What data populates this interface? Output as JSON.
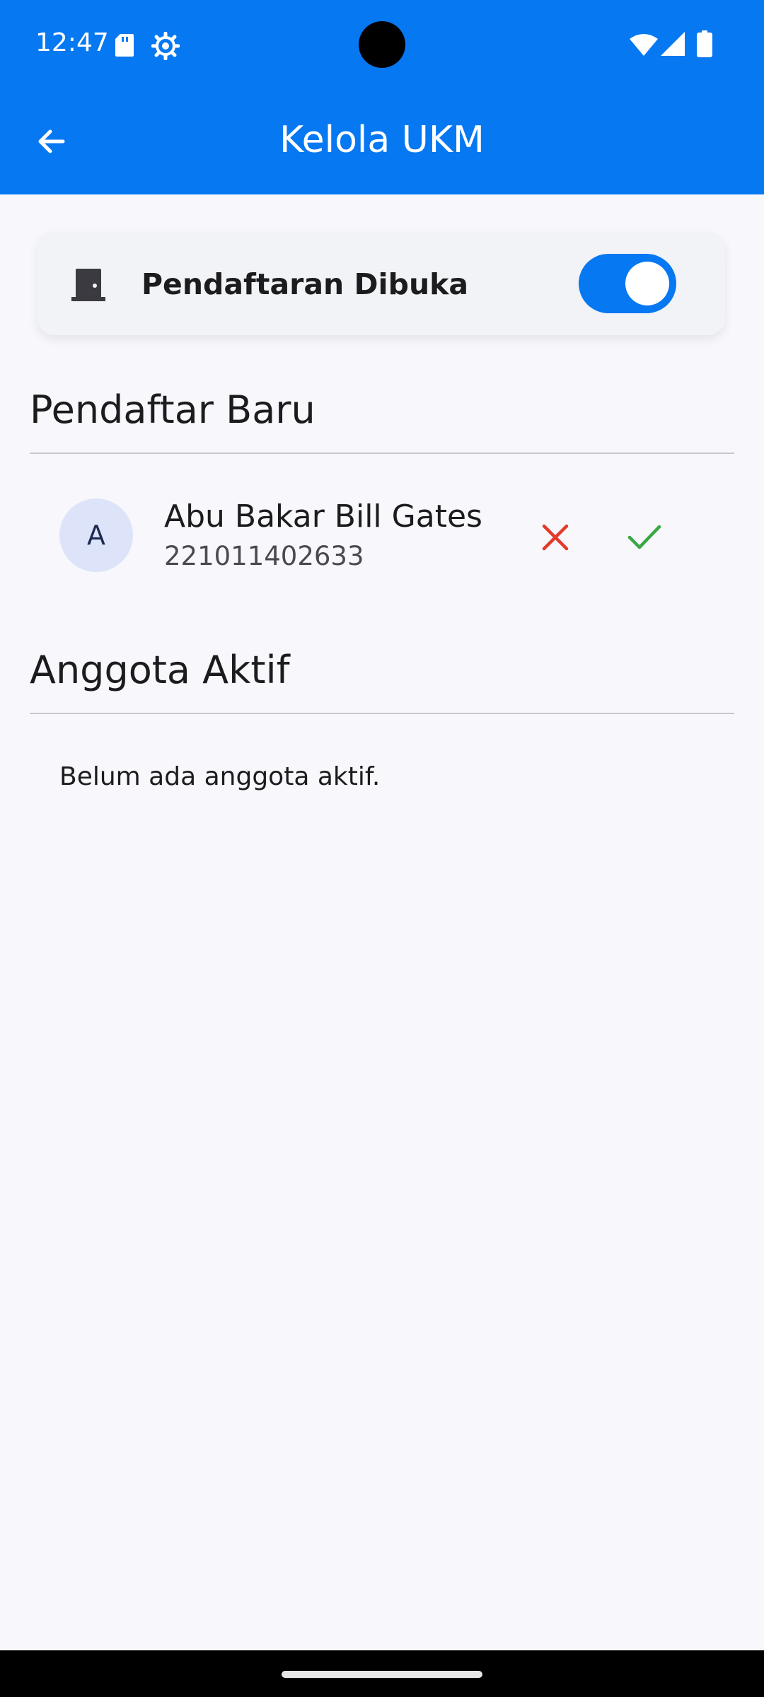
{
  "status_bar": {
    "time": "12:47",
    "icons": [
      "sd-card-icon",
      "gear-icon",
      "wifi-icon",
      "signal-icon",
      "battery-icon"
    ]
  },
  "app_bar": {
    "title": "Kelola UKM",
    "back_icon": "arrow-left-icon"
  },
  "registration": {
    "label": "Pendaftaran Dibuka",
    "icon": "door-icon",
    "toggle_on": true
  },
  "new_applicants": {
    "title": "Pendaftar Baru",
    "items": [
      {
        "initial": "A",
        "name": "Abu Bakar Bill Gates",
        "id": "221011402633"
      }
    ]
  },
  "active_members": {
    "title": "Anggota Aktif",
    "empty_text": "Belum ada anggota aktif."
  },
  "colors": {
    "primary": "#0678f2",
    "reject": "#e5392a",
    "approve": "#3ca845",
    "avatar_bg": "#dde4fa"
  }
}
